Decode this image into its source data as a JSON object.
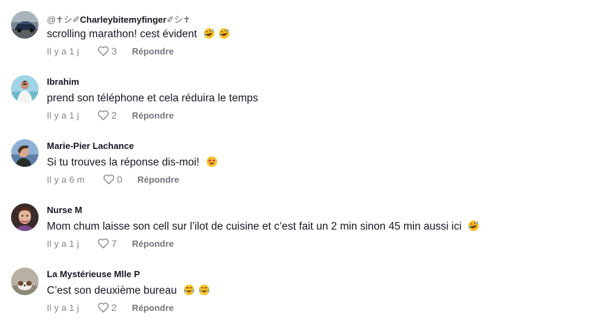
{
  "comments": [
    {
      "username_prefix": "@✝︎シ✐",
      "username": "Charleybitemyfinger",
      "username_suffix": "✐シ✝︎",
      "text": "scrolling marathon! cest évident",
      "emojis": [
        "rofl-emoji",
        "rofl-emoji"
      ],
      "time": "Il y a 1 j",
      "likes": "3",
      "reply_label": "Répondre",
      "avatar": "car-photo"
    },
    {
      "username_prefix": "",
      "username": "Ibrahim",
      "username_suffix": "",
      "text": "prend son téléphone et cela réduira le temps",
      "emojis": [],
      "time": "Il y a 1 j",
      "likes": "2",
      "reply_label": "Répondre",
      "avatar": "man-beach-photo"
    },
    {
      "username_prefix": "",
      "username": "Marie-Pier Lachance",
      "username_suffix": "",
      "text": "Si tu trouves la réponse dis-moi!",
      "emojis": [
        "star-struck-emoji"
      ],
      "time": "Il y a 6 m",
      "likes": "0",
      "reply_label": "Répondre",
      "avatar": "woman-profile-photo"
    },
    {
      "username_prefix": "",
      "username": "Nurse M",
      "username_suffix": "",
      "text": "Mom chum laisse son cell sur l’ilot de cuisine et c’est fait un 2 min sinon 45 min aussi ici",
      "emojis": [
        "rofl-emoji"
      ],
      "time": "Il y a 1 j",
      "likes": "7",
      "reply_label": "Répondre",
      "avatar": "woman-selfie-photo"
    },
    {
      "username_prefix": "",
      "username": "La Mystérieuse Mlle P",
      "username_suffix": "",
      "text": "C’est son deuxième bureau",
      "emojis": [
        "joy-emoji",
        "joy-emoji"
      ],
      "time": "Il y a 1 j",
      "likes": "2",
      "reply_label": "Répondre",
      "avatar": "dog-photo"
    }
  ],
  "colors": {
    "text_primary": "#161823",
    "text_secondary": "#8a8b91",
    "emoji_yellow": "#f7c22e"
  }
}
